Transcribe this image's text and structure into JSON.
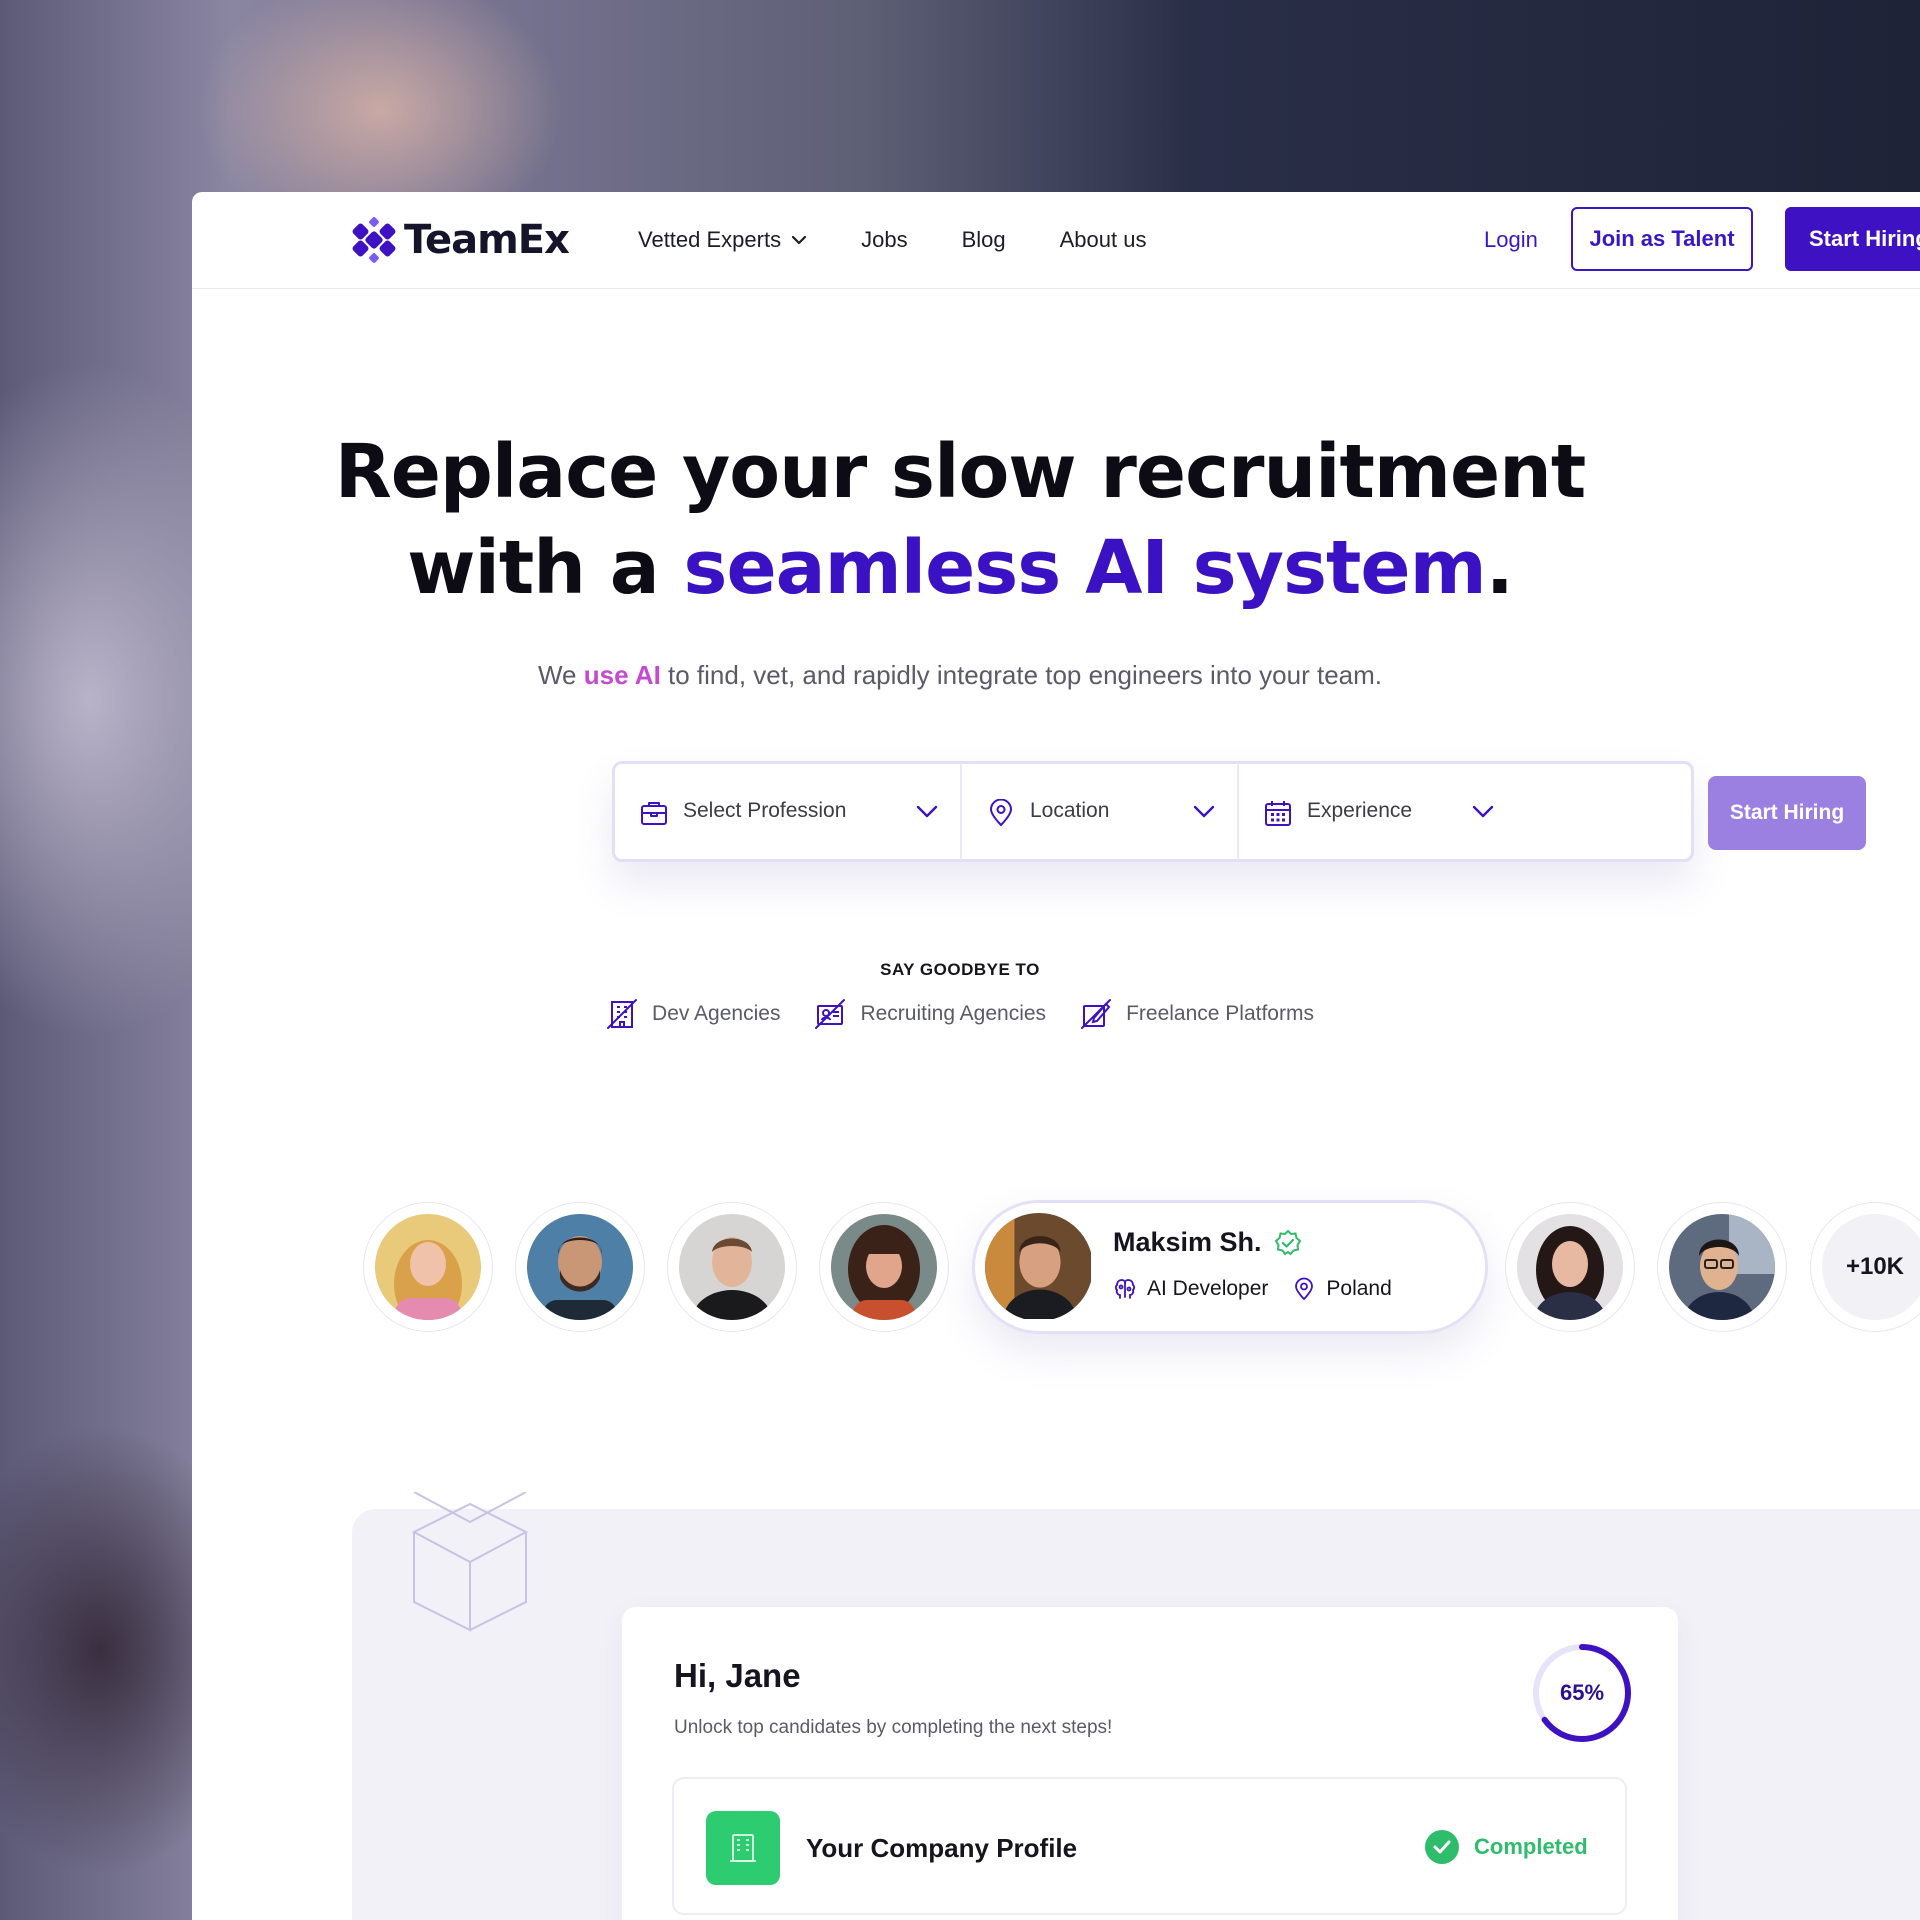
{
  "brand": {
    "name": "TeamEx",
    "accent": "#3e12c2"
  },
  "nav": {
    "links": [
      {
        "label": "Vetted Experts",
        "has_dropdown": true
      },
      {
        "label": "Jobs"
      },
      {
        "label": "Blog"
      },
      {
        "label": "About us"
      }
    ],
    "login": "Login",
    "join": "Join as Talent",
    "start": "Start Hiring"
  },
  "hero": {
    "title_line1": "Replace your slow recruitment",
    "title_line2_prefix": "with a ",
    "title_line2_accent": "seamless AI system",
    "title_line2_suffix": ".",
    "subtitle_prefix": "We ",
    "subtitle_accent": "use AI",
    "subtitle_suffix": " to find, vet, and rapidly integrate top engineers into your team."
  },
  "search": {
    "profession": "Select Profession",
    "location": "Location",
    "experience": "Experience",
    "button": "Start Hiring"
  },
  "goodbye": {
    "heading": "SAY GOODBYE TO",
    "items": [
      "Dev Agencies",
      "Recruiting Agencies",
      "Freelance Platforms"
    ]
  },
  "experts": {
    "featured": {
      "name": "Maksim Sh.",
      "role": "AI Developer",
      "location": "Poland",
      "verified": true
    },
    "more_count": "+10K"
  },
  "dashboard": {
    "greeting": "Hi, Jane",
    "subtitle": "Unlock top candidates by completing the next steps!",
    "progress_percent": 65,
    "progress_label": "65%",
    "steps": [
      {
        "title": "Your Company Profile",
        "status": "Completed"
      }
    ]
  }
}
